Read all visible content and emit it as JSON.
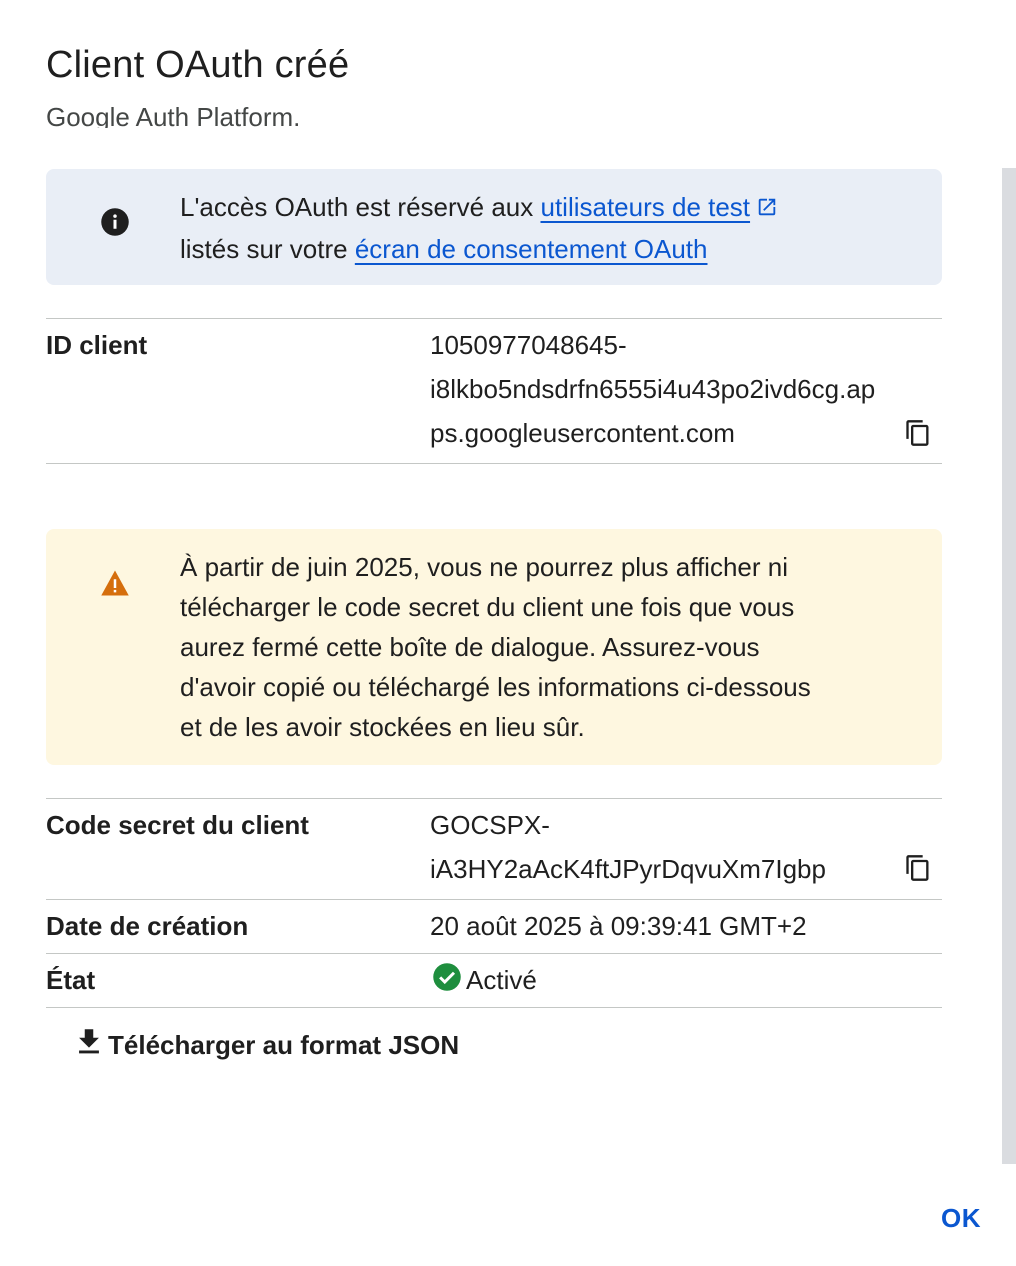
{
  "dialog": {
    "title": "Client OAuth créé",
    "cut_text": "Google Auth Platform.",
    "ok_label": "OK"
  },
  "info_banner": {
    "icon": "info-icon",
    "text_before": "L'accès OAuth est réservé aux ",
    "link_test_users": "utilisateurs de test",
    "text_middle": "listés sur votre ",
    "link_consent": "écran de consentement OAuth"
  },
  "client_id": {
    "label": "ID client",
    "value_line1": "1050977048645-",
    "value_line2": "i8lkbo5ndsdrfn6555i4u43po2ivd6cg.ap",
    "value_line3": "ps.googleusercontent.com"
  },
  "warning_banner": {
    "icon": "warning-icon",
    "color": "#d56e0c",
    "line1": "À partir de juin 2025, vous ne pourrez plus afficher ni",
    "line2": "télécharger le code secret du client une fois que vous",
    "line3": "aurez fermé cette boîte de dialogue. Assurez-vous",
    "line4": "d'avoir copié ou téléchargé les informations ci-dessous",
    "line5": "et de les avoir stockées en lieu sûr."
  },
  "client_secret": {
    "label": "Code secret du client",
    "value_line1": "GOCSPX-",
    "value_line2": "iA3HY2aAcK4ftJPyrDqvuXm7Igbp"
  },
  "creation_date": {
    "label": "Date de création",
    "value": "20 août 2025 à 09:39:41 GMT+2"
  },
  "state": {
    "label": "État",
    "value": "Activé",
    "icon": "check-circle-icon",
    "color": "#1e8e3e"
  },
  "download": {
    "label": "Télécharger au format JSON",
    "icon": "download-icon"
  },
  "colors": {
    "link": "#0b57d0",
    "info_bg": "#e9eef6",
    "warn_bg": "#fef7e0"
  }
}
